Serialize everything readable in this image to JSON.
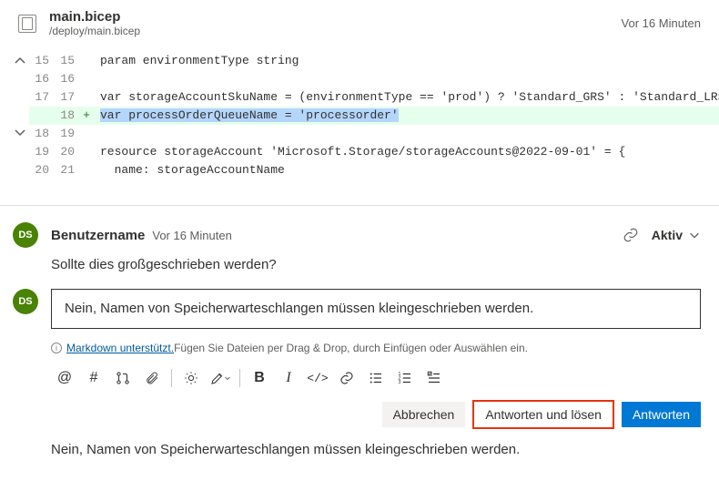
{
  "file": {
    "name": "main.bicep",
    "path": "/deploy/main.bicep",
    "timestamp": "Vor 16 Minuten"
  },
  "diff": {
    "rows": [
      {
        "old": "15",
        "new": "15",
        "mark": "",
        "text": "param environmentType string",
        "added": false
      },
      {
        "old": "16",
        "new": "16",
        "mark": "",
        "text": "",
        "added": false
      },
      {
        "old": "17",
        "new": "17",
        "mark": "",
        "text": "var storageAccountSkuName = (environmentType == 'prod') ? 'Standard_GRS' : 'Standard_LRS'",
        "added": false
      },
      {
        "old": "",
        "new": "18",
        "mark": "+",
        "text": "var processOrderQueueName = 'processorder'",
        "added": true,
        "hl": true
      },
      {
        "old": "18",
        "new": "19",
        "mark": "",
        "text": "",
        "added": false
      },
      {
        "old": "19",
        "new": "20",
        "mark": "",
        "text": "resource storageAccount 'Microsoft.Storage/storageAccounts@2022-09-01' = {",
        "added": false
      },
      {
        "old": "20",
        "new": "21",
        "mark": "",
        "text": "  name: storageAccountName",
        "added": false
      }
    ]
  },
  "thread": {
    "avatar": "DS",
    "author": "Benutzername",
    "time": "Vor 16 Minuten",
    "status": "Aktiv",
    "body": "Sollte dies großgeschrieben werden?"
  },
  "reply": {
    "avatar": "DS",
    "value": "Nein, Namen von Speicherwarteschlangen müssen kleingeschrieben werden.",
    "md_link": "Markdown unterstützt.",
    "md_hint": " Fügen Sie Dateien per Drag & Drop, durch Einfügen oder Auswählen ein."
  },
  "toolbar": {
    "mention": "@",
    "hash": "#",
    "pr": "↳↰",
    "attach": "📎",
    "bulb": "💡",
    "highlight": "✎",
    "bold": "B",
    "italic": "I",
    "code": "</>",
    "link": "🔗",
    "ul": "☰",
    "ol": "≡",
    "task": "☑≡"
  },
  "actions": {
    "cancel": "Abbrechen",
    "resolve": "Antworten und lösen",
    "reply": "Antworten"
  },
  "footer": "Nein, Namen von Speicherwarteschlangen müssen kleingeschrieben werden."
}
